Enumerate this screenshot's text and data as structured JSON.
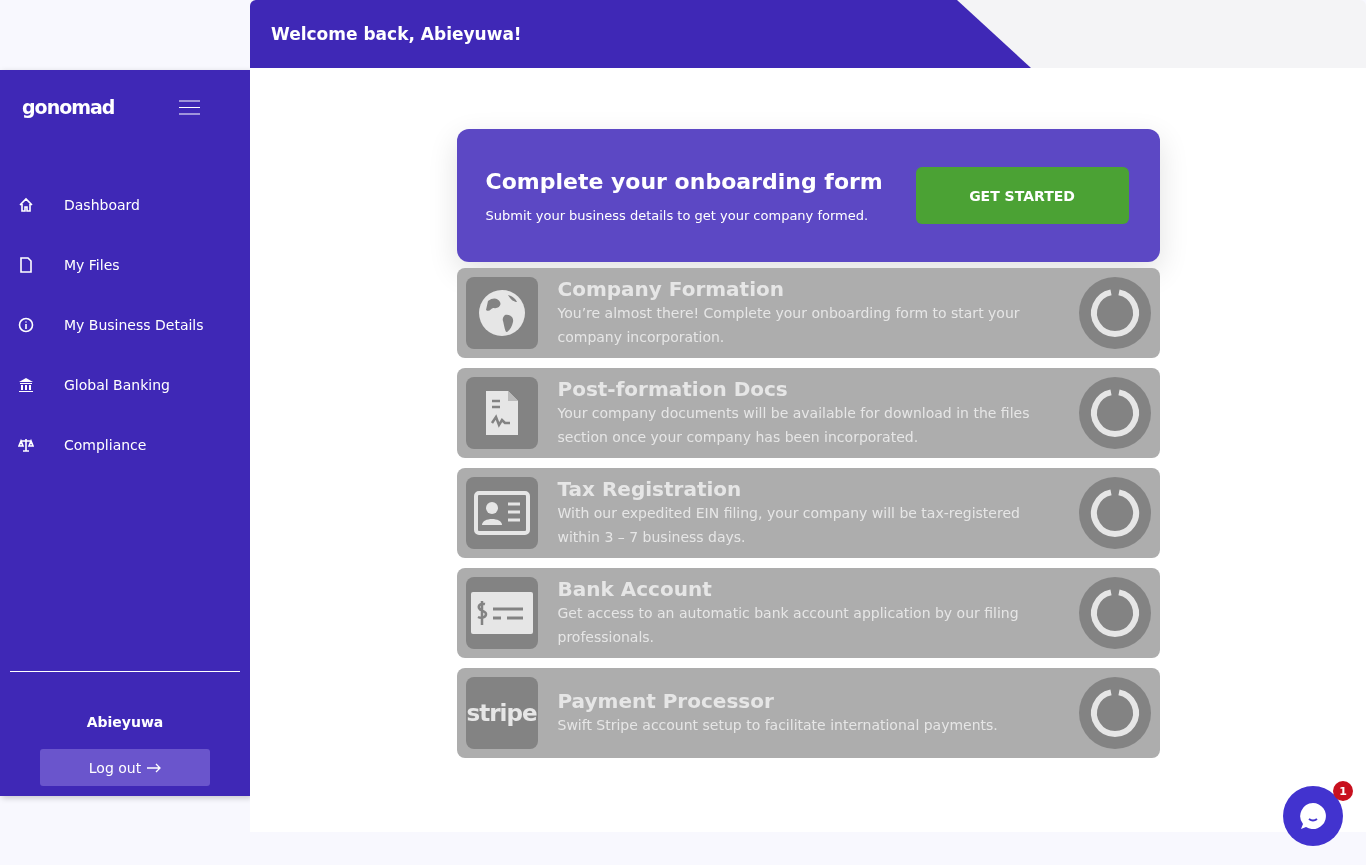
{
  "header": {
    "greeting": "Welcome back, Abieyuwa!"
  },
  "sidebar": {
    "logo": "gonomad",
    "items": [
      {
        "label": "Dashboard",
        "kind": "home"
      },
      {
        "label": "My Files",
        "kind": "file"
      },
      {
        "label": "My Business Details",
        "kind": "info"
      },
      {
        "label": "Global Banking",
        "kind": "bank"
      },
      {
        "label": "Compliance",
        "kind": "scale"
      }
    ],
    "user": "Abieyuwa",
    "logout": "Log out"
  },
  "onboarding": {
    "title": "Complete your onboarding form",
    "subtitle": "Submit your business details to get your company formed.",
    "button": "GET STARTED"
  },
  "steps": [
    {
      "kind": "globe",
      "title": "Company Formation",
      "text": "You’re almost there! Complete your onboarding form to start your company incorporation."
    },
    {
      "kind": "document",
      "title": "Post-formation Docs",
      "text": "Your company documents will be available for download in the files section once your company has been incorporated."
    },
    {
      "kind": "id-card",
      "title": "Tax Registration",
      "text": "With our expedited EIN filing, your company will be tax-registered within 3 – 7 business days."
    },
    {
      "kind": "cheque",
      "title": "Bank Account",
      "text": "Get access to an automatic bank account application by our filing professionals."
    },
    {
      "kind": "wordmark",
      "mark": "stripe",
      "title": "Payment Processor",
      "text": "Swift Stripe account setup to facilitate international payments."
    }
  ],
  "chat": {
    "badge": "1"
  }
}
